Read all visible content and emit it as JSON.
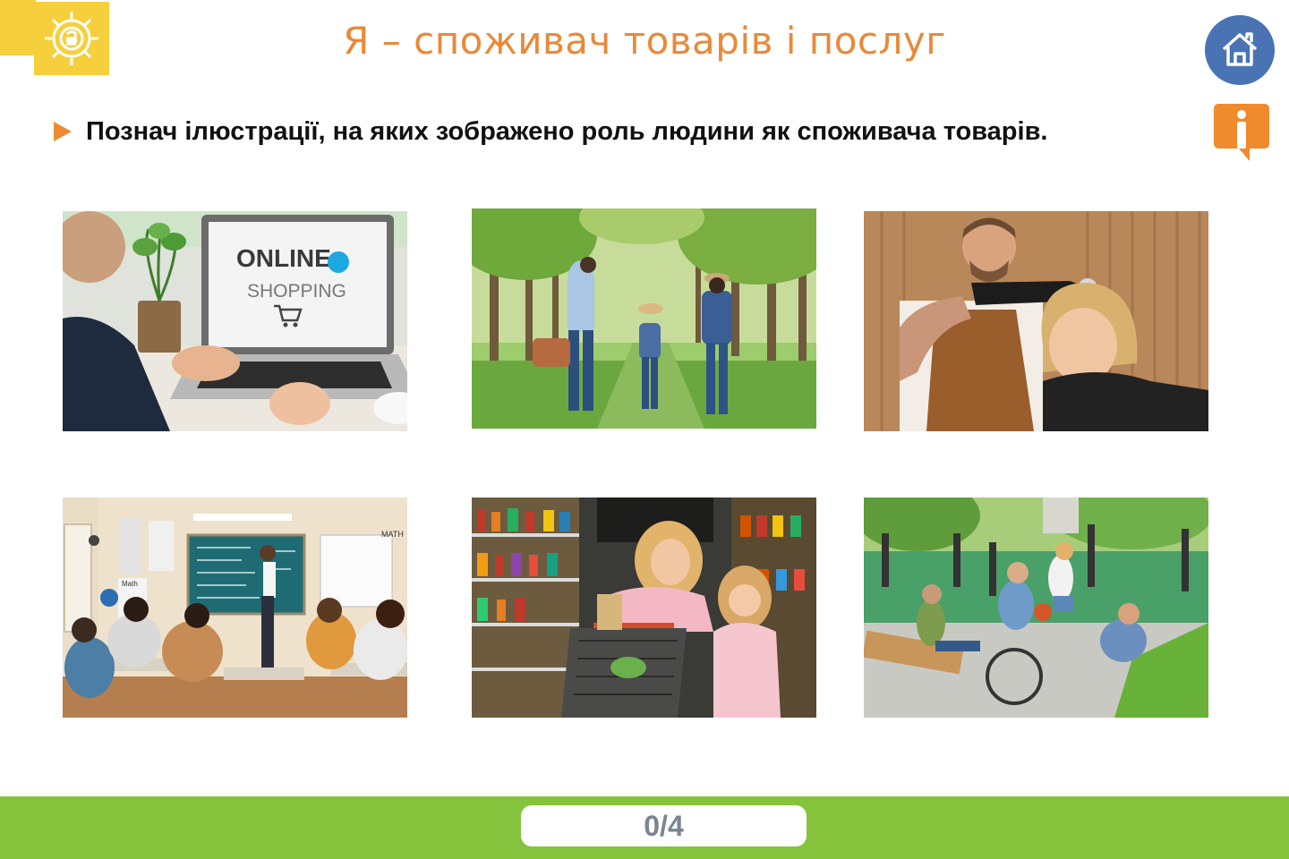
{
  "header": {
    "title": "Я – споживач товарів і послуг",
    "logo_icon": "gear-hryvnia-icon",
    "home_icon": "home-icon",
    "info_icon": "info-icon"
  },
  "task": {
    "instruction": "Познач ілюстрації, на яких зображено роль людини як споживача товарів."
  },
  "images": [
    {
      "id": "online-shopping",
      "laptop_text_1": "ONLINE",
      "laptop_text_2": "SHOPPING"
    },
    {
      "id": "family-walk-park"
    },
    {
      "id": "barber-haircut"
    },
    {
      "id": "classroom-lesson",
      "board_label_1": "MATH",
      "board_label_2": "Math"
    },
    {
      "id": "supermarket-shopping"
    },
    {
      "id": "youth-park-leisure"
    }
  ],
  "footer": {
    "counter": "0/4"
  },
  "colors": {
    "title": "#e8893a",
    "logo_bg": "#f6cf3c",
    "home_bg": "#4a73b4",
    "info_bg": "#ef8a2d",
    "bottom_bar": "#86c33d",
    "counter_text": "#7a8590"
  }
}
